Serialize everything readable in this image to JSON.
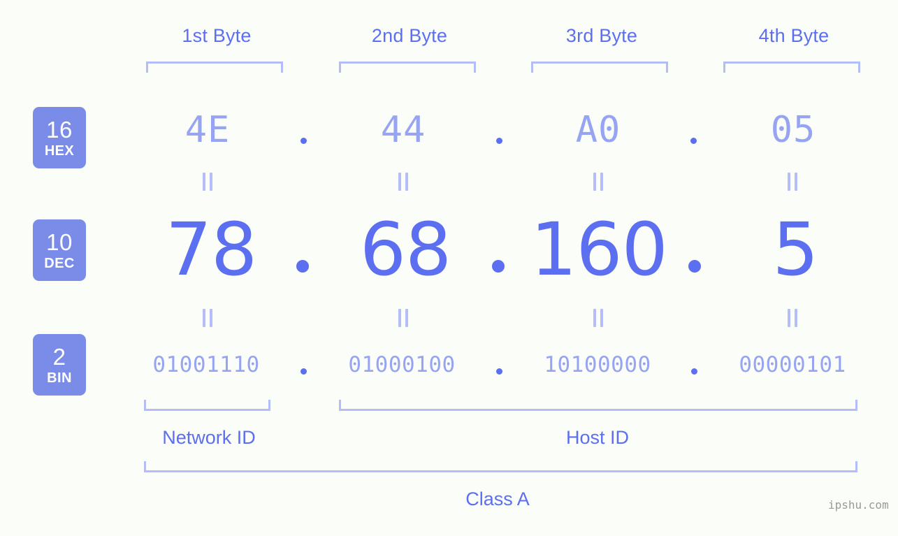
{
  "diagram": {
    "ip_decimal": "78.68.160.5",
    "class": "Class A",
    "byte_headers": [
      {
        "label": "1st Byte"
      },
      {
        "label": "2nd Byte"
      },
      {
        "label": "3rd Byte"
      },
      {
        "label": "4th Byte"
      }
    ],
    "rows": [
      {
        "badge_number": "16",
        "badge_abbr": "HEX",
        "values": [
          "4E",
          "44",
          "A0",
          "05"
        ]
      },
      {
        "badge_number": "10",
        "badge_abbr": "DEC",
        "values": [
          "78",
          "68",
          "160",
          "5"
        ]
      },
      {
        "badge_number": "2",
        "badge_abbr": "BIN",
        "values": [
          "01001110",
          "01000100",
          "10100000",
          "00000101"
        ]
      }
    ],
    "separators": {
      "dot": "."
    },
    "equals_connector": "||",
    "sections": [
      {
        "label": "Network ID"
      },
      {
        "label": "Host ID"
      }
    ],
    "class_label": "Class A",
    "watermark": "ipshu.com"
  },
  "colors": {
    "background": "#fbfdf9",
    "badge_fill": "#7b8ce8",
    "accent_strong": "#5b6ff0",
    "accent_light": "#97a4f2",
    "bracket": "#b4bdf7",
    "watermark": "#9a9a9a"
  }
}
